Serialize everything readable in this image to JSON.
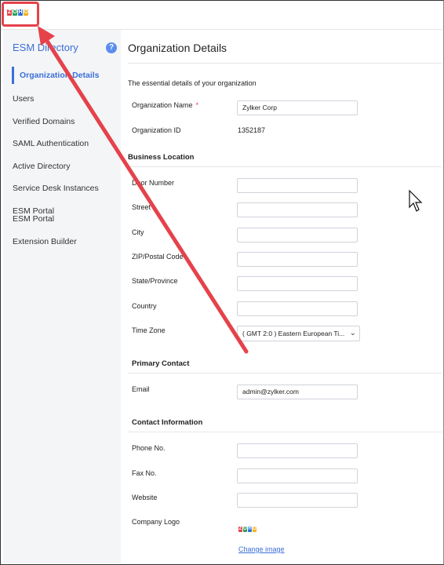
{
  "brand": {
    "logo_letters": [
      "Z",
      "O",
      "H",
      "O"
    ],
    "logo_colors": [
      "#e5424b",
      "#2aa05a",
      "#2e6fd6",
      "#f2b21a"
    ]
  },
  "sidebar": {
    "title": "ESM Directory",
    "help": "?",
    "items": [
      {
        "label": "Organization Details",
        "active": true
      },
      {
        "label": "Users"
      },
      {
        "label": "Verified Domains"
      },
      {
        "label": "SAML Authentication"
      },
      {
        "label": "Active Directory"
      },
      {
        "label": "Service Desk Instances"
      },
      {
        "label": "ESM Portal"
      },
      {
        "label": "ESM Portal"
      },
      {
        "label": "Extension Builder"
      }
    ]
  },
  "main": {
    "title": "Organization Details",
    "subtitle": "The essential details of your organization",
    "org": {
      "name_label": "Organization Name",
      "required_mark": "*",
      "name_value": "Zylker Corp",
      "id_label": "Organization ID",
      "id_value": "1352187"
    },
    "business_location": {
      "heading": "Business Location",
      "fields": [
        {
          "label": "Door Number",
          "value": ""
        },
        {
          "label": "Street",
          "value": ""
        },
        {
          "label": "City",
          "value": ""
        },
        {
          "label": "ZIP/Postal Code",
          "value": ""
        },
        {
          "label": "State/Province",
          "value": ""
        },
        {
          "label": "Country",
          "value": ""
        }
      ],
      "timezone_label": "Time Zone",
      "timezone_value": "( GMT 2:0 ) Eastern European Ti..."
    },
    "primary_contact": {
      "heading": "Primary Contact",
      "email_label": "Email",
      "email_value": "admin@zylker.com"
    },
    "contact_information": {
      "heading": "Contact Information",
      "fields": [
        {
          "label": "Phone No.",
          "value": ""
        },
        {
          "label": "Fax No.",
          "value": ""
        },
        {
          "label": "Website",
          "value": ""
        }
      ],
      "logo_label": "Company Logo",
      "change_image": "Change image"
    }
  },
  "colors": {
    "accent": "#3a6fd8",
    "annotation": "#e5424b"
  }
}
